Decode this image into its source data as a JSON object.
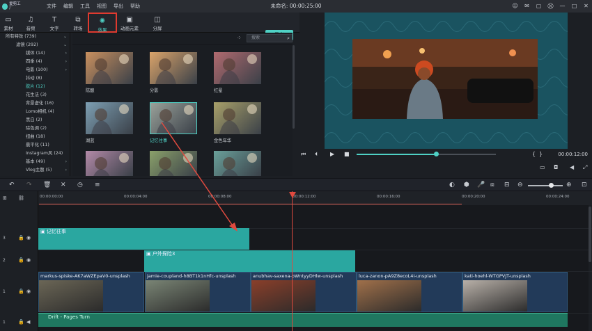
{
  "app": {
    "logo_text": "爱剪工厂",
    "window_title": "未命名: 00:00:25:00"
  },
  "menu": [
    "文件",
    "编辑",
    "工具",
    "视图",
    "导出",
    "帮助"
  ],
  "window_controls": [
    "user-icon",
    "mail-icon",
    "file-icon",
    "cart-icon",
    "minimize-icon",
    "maximize-icon",
    "close-icon"
  ],
  "toolbar": {
    "items": [
      {
        "label": "素材",
        "icon": "folder-icon"
      },
      {
        "label": "音频",
        "icon": "music-icon"
      },
      {
        "label": "文字",
        "icon": "text-icon"
      },
      {
        "label": "转场",
        "icon": "transition-icon"
      },
      {
        "label": "效果",
        "icon": "effects-icon"
      },
      {
        "label": "动画元素",
        "icon": "image-icon"
      },
      {
        "label": "分屏",
        "icon": "split-screen-icon"
      }
    ],
    "export_label": "导出"
  },
  "categories": [
    {
      "label": "所有特效 (739)",
      "arrow": "⌄"
    },
    {
      "label": "滤镜 (292)",
      "arrow": "⌄"
    },
    {
      "label": "媒体 (14)",
      "arrow": "›"
    },
    {
      "label": "四季 (4)",
      "arrow": "›"
    },
    {
      "label": "电影 (100)",
      "arrow": "›"
    },
    {
      "label": "抖动 (8)",
      "arrow": ""
    },
    {
      "label": "胶片 (12)",
      "arrow": ""
    },
    {
      "label": "花生法 (3)",
      "arrow": ""
    },
    {
      "label": "背景虚化 (16)",
      "arrow": ""
    },
    {
      "label": "Lomo相机 (4)",
      "arrow": ""
    },
    {
      "label": "黑白 (2)",
      "arrow": ""
    },
    {
      "label": "除色调 (2)",
      "arrow": ""
    },
    {
      "label": "扭曲 (18)",
      "arrow": ""
    },
    {
      "label": "晨平化 (11)",
      "arrow": ""
    },
    {
      "label": "Instagram风 (24)",
      "arrow": ""
    },
    {
      "label": "基本 (49)",
      "arrow": "›"
    },
    {
      "label": "Vlog主题 (5)",
      "arrow": "›"
    }
  ],
  "search": {
    "placeholder": "搜索"
  },
  "effects": [
    {
      "label": "陈酿",
      "color": "#c9905f"
    },
    {
      "label": "分影",
      "color": "#d9a36a"
    },
    {
      "label": "红晕",
      "color": "#b06a6f"
    },
    {
      "label": "湖蓝",
      "color": "#7d9fb3"
    },
    {
      "label": "记忆往事",
      "color": "#9aa19a"
    },
    {
      "label": "金色年华",
      "color": "#a8a06a"
    },
    {
      "label": "",
      "color": "#b38aa8"
    },
    {
      "label": "",
      "color": "#8aa06a"
    },
    {
      "label": "",
      "color": "#6aa09a"
    }
  ],
  "preview": {
    "time": "00:00:12:00",
    "progress": 0.57
  },
  "ruler_ticks": [
    "00:00:00:00",
    "00:00:04:00",
    "00:00:08:00",
    "00:00:12:00",
    "00:00:16:00",
    "00:00:20:00",
    "00:00:24:00"
  ],
  "tracks": {
    "effect_clip_1": "记忆往事",
    "effect_clip_2": "户外探险3",
    "video_clips": [
      {
        "label": "markus-spiske-AK7aWZEpaV0-unsplash",
        "color": "#6b6656"
      },
      {
        "label": "jamie-coupland-h8BT1k1nHfc-unsplash",
        "color": "#7a8575"
      },
      {
        "label": "anubhav-saxena-oWntyyDHlw-unsplash",
        "color": "#8a3f2a"
      },
      {
        "label": "luca-zanon-pA9Z8ecoL4I-unsplash",
        "color": "#a0704a"
      },
      {
        "label": "kati-hoehl-WTGPVJT-unsplash",
        "color": "#b8b0a8"
      }
    ],
    "audio_clip": "Drift - Pages Turn",
    "track_numbers": [
      "3",
      "2",
      "1",
      "1"
    ]
  }
}
